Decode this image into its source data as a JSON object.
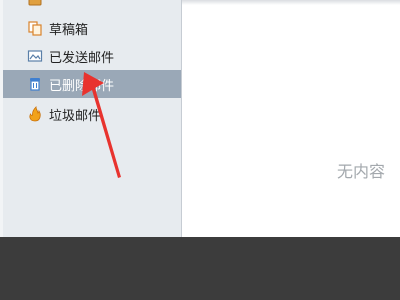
{
  "sidebar": {
    "items": [
      {
        "label": "",
        "icon": "folder-icon"
      },
      {
        "label": "草稿箱",
        "icon": "drafts-icon"
      },
      {
        "label": "已发送邮件",
        "icon": "sent-mail-icon"
      },
      {
        "label": "已删除邮件",
        "icon": "trash-icon",
        "selected": true
      },
      {
        "label": "垃圾邮件",
        "icon": "spam-icon"
      }
    ]
  },
  "main": {
    "empty_text": "无内容"
  },
  "colors": {
    "sidebar_bg": "#e7ebef",
    "selected_bg": "#9aa8b7",
    "arrow": "#e8332e",
    "empty_text": "#a3a8ad",
    "taskbar": "#3c3c3c"
  }
}
